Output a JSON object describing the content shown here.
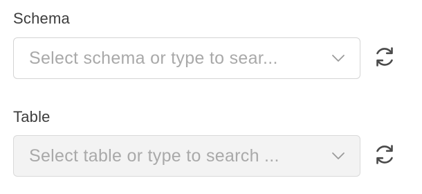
{
  "schema_field": {
    "label": "Schema",
    "placeholder": "Select schema or type to sear...",
    "disabled": false
  },
  "table_field": {
    "label": "Table",
    "placeholder": "Select table or type to search ...",
    "disabled": true
  },
  "icons": {
    "dropdown": "chevron-down-icon",
    "refresh": "refresh-icon"
  },
  "colors": {
    "label_text": "#3d3d3d",
    "placeholder_text": "#a9a9a9",
    "border": "#d4d4d4",
    "disabled_bg": "#f3f3f3",
    "icon": "#4a4a4a"
  }
}
